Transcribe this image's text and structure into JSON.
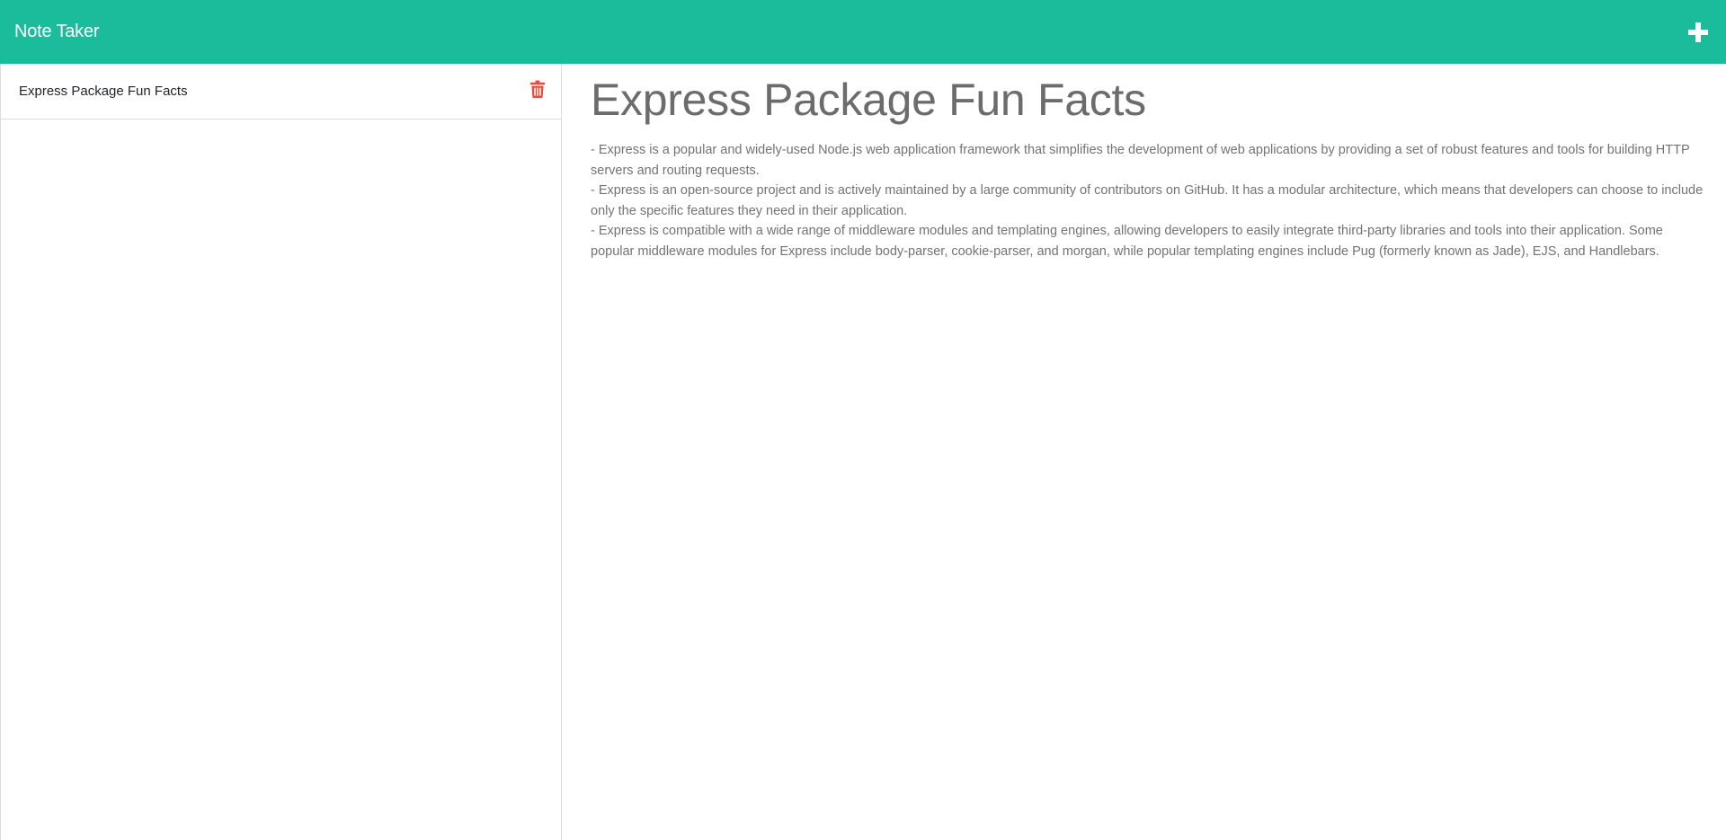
{
  "app": {
    "title": "Note Taker",
    "accent_color": "#1abc9c",
    "new_note_icon": "plus-icon"
  },
  "sidebar": {
    "notes": [
      {
        "title": "Express Package Fun Facts",
        "delete_icon": "trash-icon",
        "delete_icon_color": "#e74c3c"
      }
    ]
  },
  "editor": {
    "title": "Express Package Fun Facts",
    "text": "- Express is a popular and widely-used Node.js web application framework that simplifies the development of web applications by providing a set of robust features and tools for building HTTP servers and routing requests.\n- Express is an open-source project and is actively maintained by a large community of contributors on GitHub. It has a modular architecture, which means that developers can choose to include only the specific features they need in their application.\n- Express is compatible with a wide range of middleware modules and templating engines, allowing developers to easily integrate third-party libraries and tools into their application. Some popular middleware modules for Express include body-parser, cookie-parser, and morgan, while popular templating engines include Pug (formerly known as Jade), EJS, and Handlebars."
  }
}
